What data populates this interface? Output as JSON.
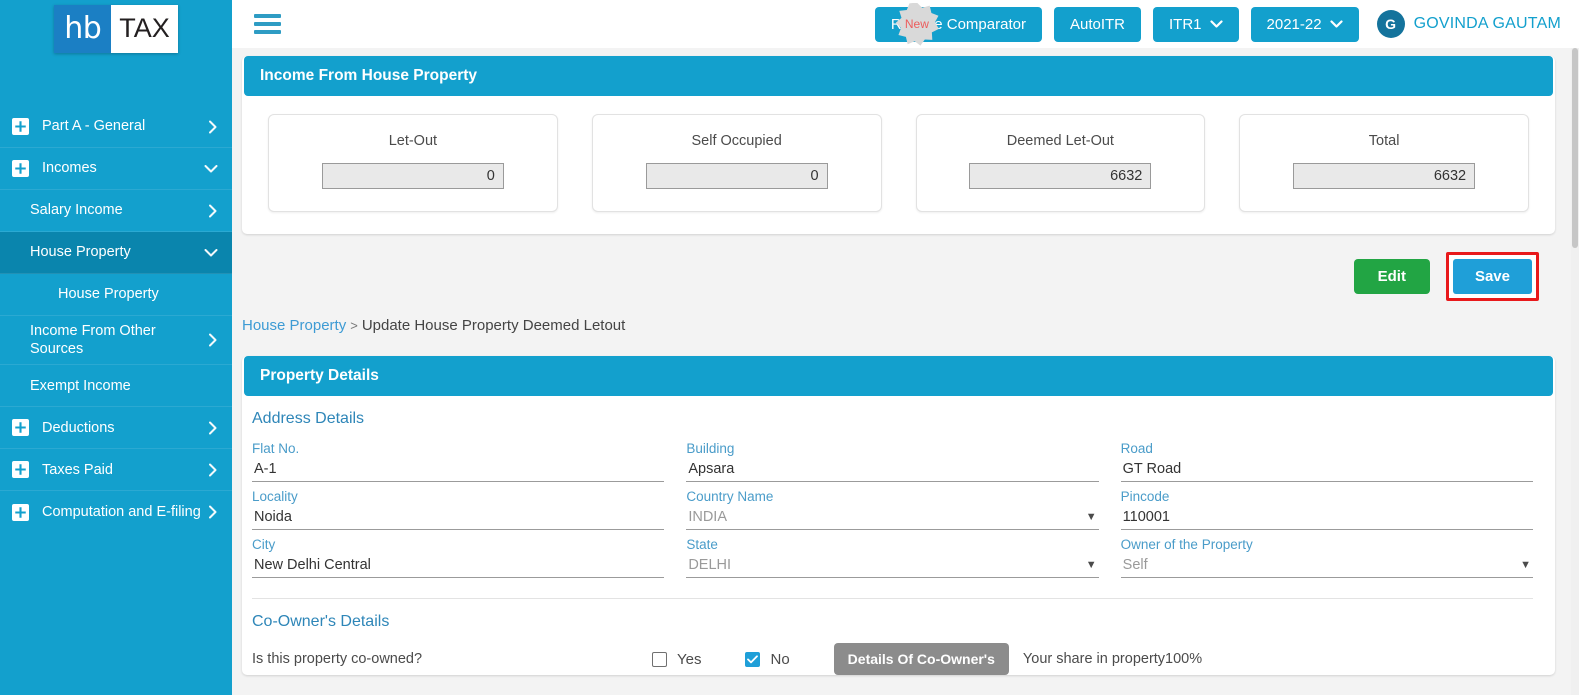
{
  "sidebar": {
    "logo": {
      "part1": "hb",
      "part2": "TAX"
    },
    "items": [
      {
        "label": "Part A - General",
        "icon": "plus-icon",
        "chevron": "chevron-right-icon",
        "level": 0,
        "active": false
      },
      {
        "label": "Incomes",
        "icon": "plus-icon",
        "chevron": "chevron-down-icon",
        "level": 0,
        "active": false
      },
      {
        "label": "Salary Income",
        "chevron": "chevron-right-icon",
        "level": 1,
        "active": false
      },
      {
        "label": "House Property",
        "chevron": "chevron-down-icon",
        "level": 1,
        "active": true
      },
      {
        "label": "House Property",
        "level": 2,
        "active": false
      },
      {
        "label": "Income From Other Sources",
        "chevron": "chevron-right-icon",
        "level": 1,
        "active": false
      },
      {
        "label": "Exempt Income",
        "level": 1,
        "active": false
      },
      {
        "label": "Deductions",
        "icon": "plus-icon",
        "chevron": "chevron-right-icon",
        "level": 0,
        "active": false
      },
      {
        "label": "Taxes Paid",
        "icon": "plus-icon",
        "chevron": "chevron-right-icon",
        "level": 0,
        "active": false
      },
      {
        "label": "Computation and E-filing",
        "icon": "plus-icon",
        "chevron": "chevron-right-icon",
        "level": 0,
        "active": false
      }
    ]
  },
  "topbar": {
    "menu_icon": "hamburger-icon",
    "new_badge": "New",
    "regime_comparator": "Regime Comparator",
    "auto_itr": "AutoITR",
    "itr_form": "ITR1",
    "assessment_year": "2021-22",
    "avatar_initial": "G",
    "user_name": "GOVINDA GAUTAM"
  },
  "income_panel": {
    "title": "Income From House Property",
    "cards": [
      {
        "label": "Let-Out",
        "value": "0"
      },
      {
        "label": "Self Occupied",
        "value": "0"
      },
      {
        "label": "Deemed Let-Out",
        "value": "6632"
      },
      {
        "label": "Total",
        "value": "6632"
      }
    ]
  },
  "actions": {
    "edit": "Edit",
    "save": "Save"
  },
  "breadcrumb": {
    "link": "House Property",
    "separator": ">",
    "current": "Update House Property Deemed Letout"
  },
  "property_panel": {
    "title": "Property Details",
    "address_section_title": "Address Details",
    "fields": [
      {
        "label": "Flat No.",
        "value": "A-1",
        "type": "text",
        "muted": false
      },
      {
        "label": "Building",
        "value": "Apsara",
        "type": "text",
        "muted": false
      },
      {
        "label": "Road",
        "value": "GT Road",
        "type": "text",
        "muted": false
      },
      {
        "label": "Locality",
        "value": "Noida",
        "type": "text",
        "muted": false
      },
      {
        "label": "Country Name",
        "value": "INDIA",
        "type": "select",
        "muted": true
      },
      {
        "label": "Pincode",
        "value": "110001",
        "type": "text",
        "muted": false
      },
      {
        "label": "City",
        "value": "New Delhi Central",
        "type": "text",
        "muted": false
      },
      {
        "label": "State",
        "value": "DELHI",
        "type": "select",
        "muted": true
      },
      {
        "label": "Owner of the Property",
        "value": "Self",
        "type": "select",
        "muted": true
      }
    ],
    "coowner_section_title": "Co-Owner's Details",
    "coowner_question": "Is this property co-owned?",
    "yes_label": "Yes",
    "no_label": "No",
    "yes_checked": false,
    "no_checked": true,
    "details_button": "Details Of Co-Owner's",
    "share_text": "Your share in property100%"
  },
  "colors": {
    "brand_blue": "#13a0cd",
    "sidebar_active": "#0a85ad",
    "edit_green": "#22a544",
    "save_blue": "#1f9fd8",
    "highlight_red": "#e8191b",
    "label_blue": "#4a9cc9",
    "section_blue": "#2e86b8"
  }
}
